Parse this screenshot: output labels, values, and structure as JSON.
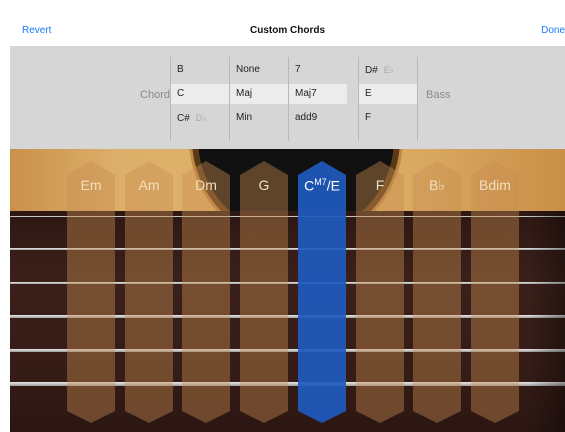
{
  "nav": {
    "revert": "Revert",
    "title": "Custom Chords",
    "done": "Done"
  },
  "picker": {
    "chord_label": "Chord",
    "bass_label": "Bass",
    "root_col": [
      {
        "text": "B",
        "alt": ""
      },
      {
        "text": "C",
        "alt": ""
      },
      {
        "text": "C#",
        "alt": "D♭"
      }
    ],
    "type_col": [
      "None",
      "Maj",
      "Min"
    ],
    "ext_col": [
      "7",
      "Maj7",
      "add9"
    ],
    "bass_col": [
      {
        "text": "D#",
        "alt": "E♭"
      },
      {
        "text": "E",
        "alt": ""
      },
      {
        "text": "F",
        "alt": ""
      }
    ]
  },
  "chords": [
    {
      "label": "Em"
    },
    {
      "label": "Am"
    },
    {
      "label": "Dm"
    },
    {
      "label": "G"
    },
    {
      "label": "C",
      "sup": "M7",
      "suffix": "/E",
      "active": true
    },
    {
      "label": "F"
    },
    {
      "label": "B♭"
    },
    {
      "label": "Bdim"
    }
  ],
  "colors": {
    "accent": "#1a7cf5",
    "selected_chord": "#1e5abe",
    "wood": "#e0b26c",
    "fretboard": "#351c16"
  }
}
